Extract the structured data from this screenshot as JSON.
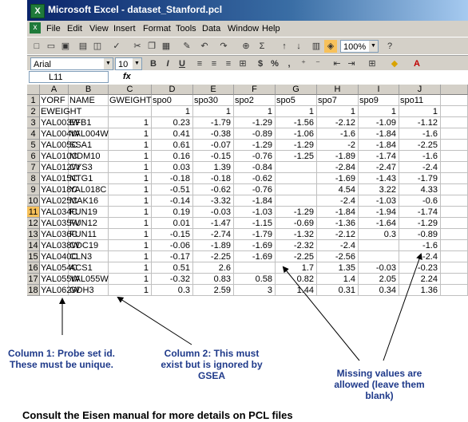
{
  "window": {
    "title": "Microsoft Excel - dataset_Stanford.pcl"
  },
  "menu": [
    "File",
    "Edit",
    "View",
    "Insert",
    "Format",
    "Tools",
    "Data",
    "Window",
    "Help"
  ],
  "toolbar": {
    "zoom": "100%"
  },
  "format_bar": {
    "font": "Arial",
    "size": "10",
    "bold": "B",
    "italic": "I",
    "underline": "U",
    "currency": "$",
    "percent": "%",
    "comma": ","
  },
  "formula_bar": {
    "name_box": "L11",
    "fx": "fx",
    "value": ""
  },
  "grid": {
    "columns": [
      "A",
      "B",
      "C",
      "D",
      "E",
      "F",
      "G",
      "H",
      "I",
      "J"
    ],
    "rows": [
      [
        "YORF",
        "NAME",
        "GWEIGHT",
        "spo0",
        "spo30",
        "spo2",
        "spo5",
        "spo7",
        "spo9",
        "spo11"
      ],
      [
        "EWEIGHT",
        "",
        "",
        "1",
        "1",
        "1",
        "1",
        "1",
        "1",
        "1"
      ],
      [
        "YAL003W",
        "EFB1",
        "1",
        "0.23",
        "-1.79",
        "-1.29",
        "-1.56",
        "-2.12",
        "-1.09",
        "-1.12"
      ],
      [
        "YAL004W",
        "YAL004W",
        "1",
        "0.41",
        "-0.38",
        "-0.89",
        "-1.06",
        "-1.6",
        "-1.84",
        "-1.6"
      ],
      [
        "YAL005C",
        "SSA1",
        "1",
        "0.61",
        "-0.07",
        "-1.29",
        "-1.29",
        "-2",
        "-1.84",
        "-2.25"
      ],
      [
        "YAL010C",
        "MDM10",
        "1",
        "0.16",
        "-0.15",
        "-0.76",
        "-1.25",
        "-1.89",
        "-1.74",
        "-1.6"
      ],
      [
        "YAL012W",
        "CYS3",
        "1",
        "0.03",
        "1.39",
        "-0.84",
        "",
        "-2.84",
        "-2.47",
        "-2.4"
      ],
      [
        "YAL015C",
        "NTG1",
        "1",
        "-0.18",
        "-0.18",
        "-0.62",
        "",
        "-1.69",
        "-1.43",
        "-1.79"
      ],
      [
        "YAL018C",
        "YAL018C",
        "1",
        "-0.51",
        "-0.62",
        "-0.76",
        "",
        "4.54",
        "3.22",
        "4.33"
      ],
      [
        "YAL025C",
        "MAK16",
        "1",
        "-0.14",
        "-3.32",
        "-1.84",
        "",
        "-2.4",
        "-1.03",
        "-0.6"
      ],
      [
        "YAL034C",
        "FUN19",
        "1",
        "0.19",
        "-0.03",
        "-1.03",
        "-1.29",
        "-1.84",
        "-1.94",
        "-1.74"
      ],
      [
        "YAL035W",
        "FUN12",
        "1",
        "0.01",
        "-1.47",
        "-1.15",
        "-0.69",
        "-1.36",
        "-1.64",
        "-1.29"
      ],
      [
        "YAL036C",
        "FUN11",
        "1",
        "-0.15",
        "-2.74",
        "-1.79",
        "-1.32",
        "-2.12",
        "0.3",
        "-0.89"
      ],
      [
        "YAL038W",
        "CDC19",
        "1",
        "-0.06",
        "-1.89",
        "-1.69",
        "-2.32",
        "-2.4",
        "",
        "-1.6"
      ],
      [
        "YAL040C",
        "CLN3",
        "1",
        "-0.17",
        "-2.25",
        "-1.69",
        "-2.25",
        "-2.56",
        "",
        "-2.4"
      ],
      [
        "YAL054C",
        "ACS1",
        "1",
        "0.51",
        "2.6",
        "",
        "1.7",
        "1.35",
        "-0.03",
        "-0.23"
      ],
      [
        "YAL055W",
        "YAL055W",
        "1",
        "-0.32",
        "0.83",
        "0.58",
        "0.82",
        "1.4",
        "2.05",
        "2.24"
      ],
      [
        "YAL062W",
        "GDH3",
        "1",
        "0.3",
        "2.59",
        "3",
        "1.44",
        "0.31",
        "0.34",
        "1.36"
      ]
    ],
    "selected_row": "11"
  },
  "annotations": {
    "col1": [
      "Column 1: Probe set id.",
      "These must be unique."
    ],
    "col2": [
      "Column 2: This must",
      "exist but is ignored by",
      "GSEA"
    ],
    "missing": [
      "Missing values are",
      "allowed (leave them",
      "blank)"
    ]
  },
  "footer": "Consult the Eisen manual for more details on PCL files"
}
